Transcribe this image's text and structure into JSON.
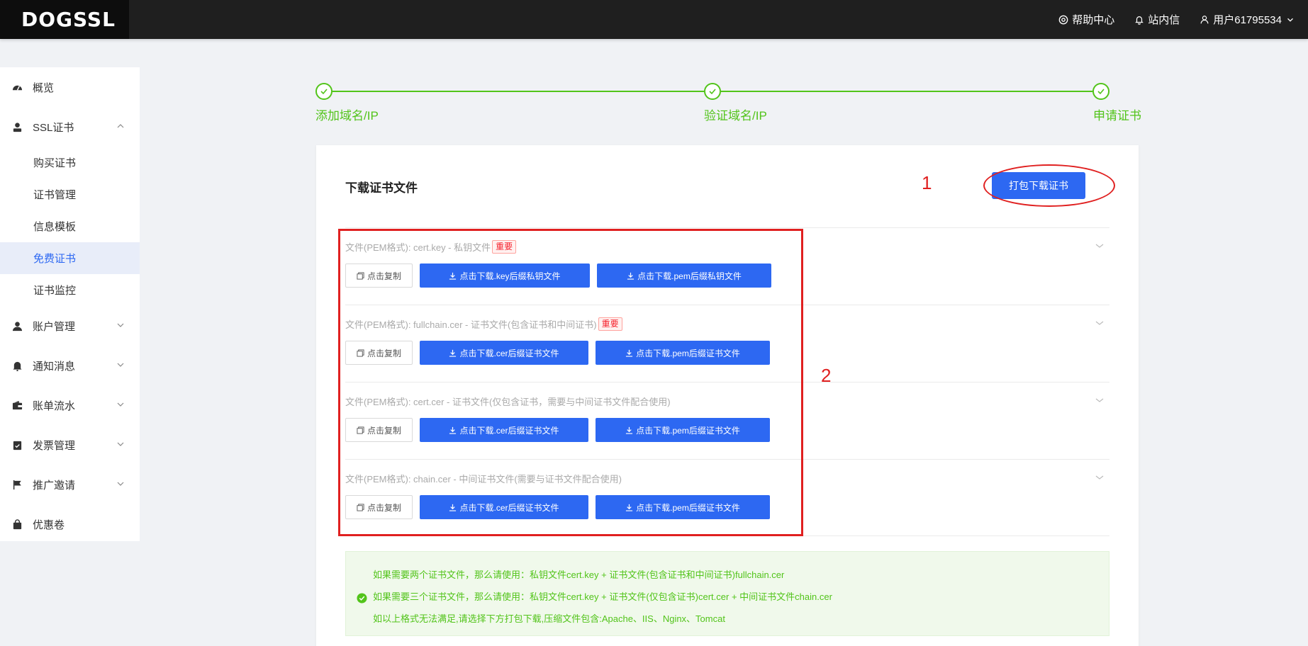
{
  "header": {
    "logo": "DOGSSL",
    "help": "帮助中心",
    "messages": "站内信",
    "user": "用户61795534"
  },
  "sidebar": {
    "overview": "概览",
    "ssl": "SSL证书",
    "ssl_items": [
      "购买证书",
      "证书管理",
      "信息模板",
      "免费证书",
      "证书监控"
    ],
    "account": "账户管理",
    "notify": "通知消息",
    "billing": "账单流水",
    "invoice": "发票管理",
    "promo": "推广邀请",
    "coupon": "优惠卷"
  },
  "steps": [
    "添加域名/IP",
    "验证域名/IP",
    "申请证书"
  ],
  "card": {
    "title": "下载证书文件",
    "pack_button": "打包下载证书",
    "annotation_1": "1",
    "annotation_2": "2",
    "copy_label": "点击复制",
    "important": "重要",
    "files": [
      {
        "label": "文件(PEM格式): cert.key - 私钥文件",
        "important": true,
        "btn1": "点击下载.key后缀私钥文件",
        "btn2": "点击下载.pem后缀私钥文件"
      },
      {
        "label": "文件(PEM格式): fullchain.cer - 证书文件(包含证书和中间证书)",
        "important": true,
        "btn1": "点击下载.cer后缀证书文件",
        "btn2": "点击下载.pem后缀证书文件"
      },
      {
        "label": "文件(PEM格式): cert.cer - 证书文件(仅包含证书，需要与中间证书文件配合使用)",
        "important": false,
        "btn1": "点击下载.cer后缀证书文件",
        "btn2": "点击下载.pem后缀证书文件"
      },
      {
        "label": "文件(PEM格式): chain.cer - 中间证书文件(需要与证书文件配合使用)",
        "important": false,
        "btn1": "点击下载.cer后缀证书文件",
        "btn2": "点击下载.pem后缀证书文件"
      }
    ],
    "tips": [
      "如果需要两个证书文件，那么请使用：私钥文件cert.key + 证书文件(包含证书和中间证书)fullchain.cer",
      "如果需要三个证书文件，那么请使用：私钥文件cert.key + 证书文件(仅包含证书)cert.cer + 中间证书文件chain.cer",
      "如以上格式无法满足,请选择下方打包下载,压缩文件包含:Apache、IIS、Nginx、Tomcat"
    ]
  },
  "colors": {
    "primary": "#2d68f2",
    "success": "#52c41a",
    "annotation": "#e02020"
  }
}
